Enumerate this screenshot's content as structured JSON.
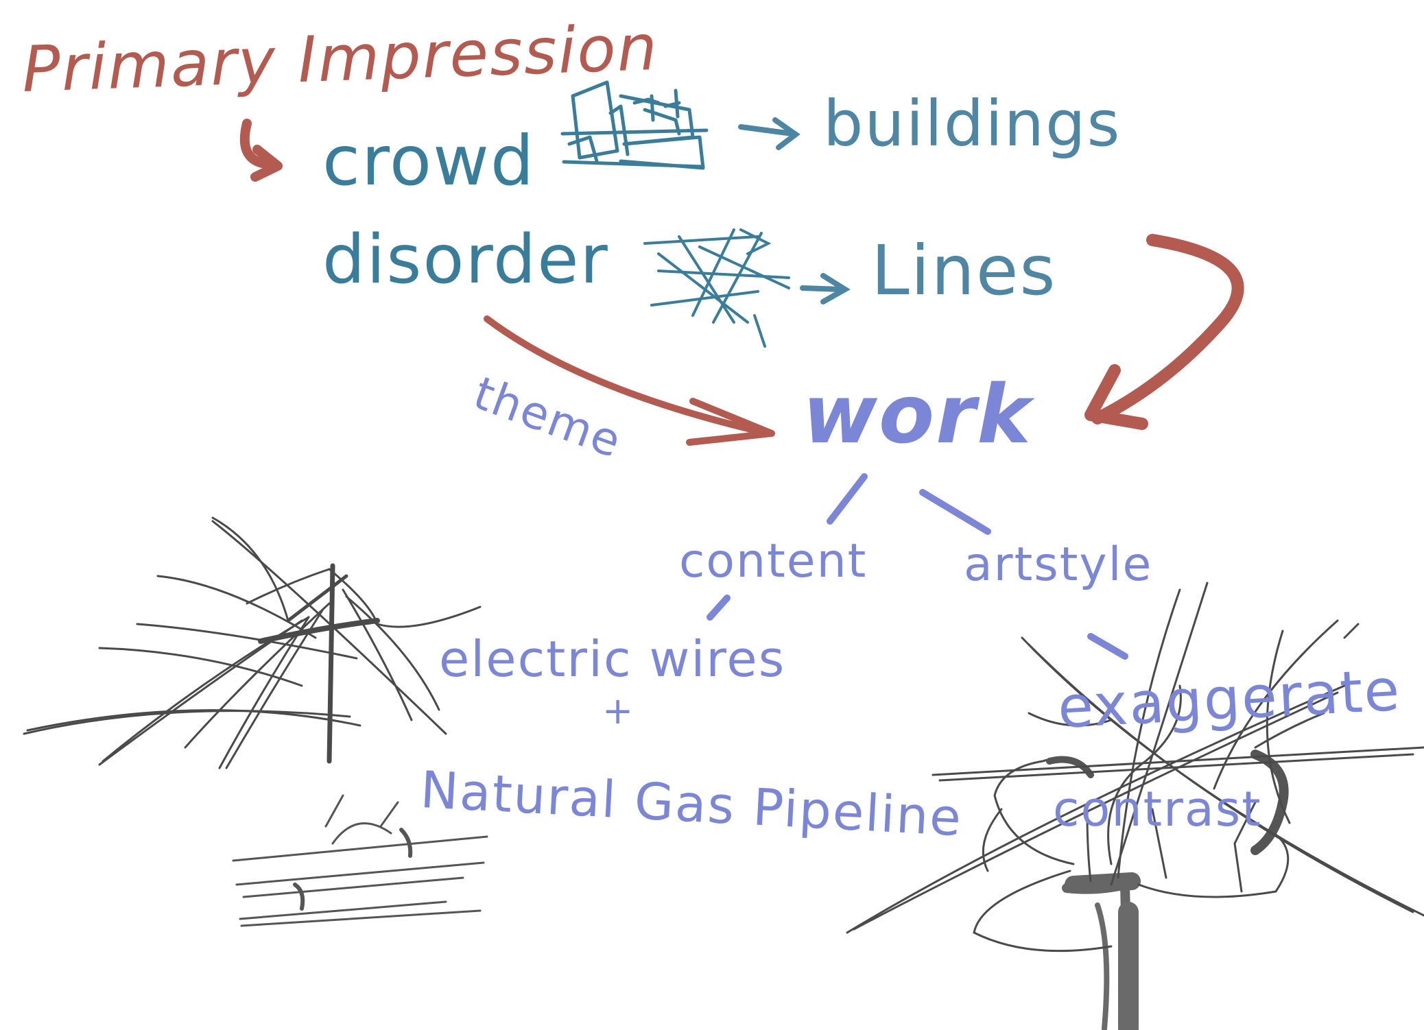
{
  "colors": {
    "red": "#b35b50",
    "teal": "#3a7d9b",
    "purple": "#7b86d6",
    "sketch": "#4a4a4a"
  },
  "title": "Primary Impression",
  "words": {
    "crowd": "crowd",
    "buildings": "buildings",
    "disorder": "disorder",
    "lines": "Lines",
    "theme": "theme",
    "work": "work",
    "content": "content",
    "artstyle": "artstyle",
    "electric_wires": "electric wires",
    "plus": "+",
    "natural_gas_pipeline": "Natural Gas Pipeline",
    "exaggerate": "exaggerate",
    "contrast": "contrast"
  },
  "icons": {
    "building_sketch": "buildings-sketch-icon",
    "scribble_lines": "scribble-lines-icon",
    "power_pole_sketch": "power-pole-sketch",
    "pipeline_sketch": "pipeline-sketch",
    "tree_wires_sketch": "tree-wires-sketch"
  }
}
